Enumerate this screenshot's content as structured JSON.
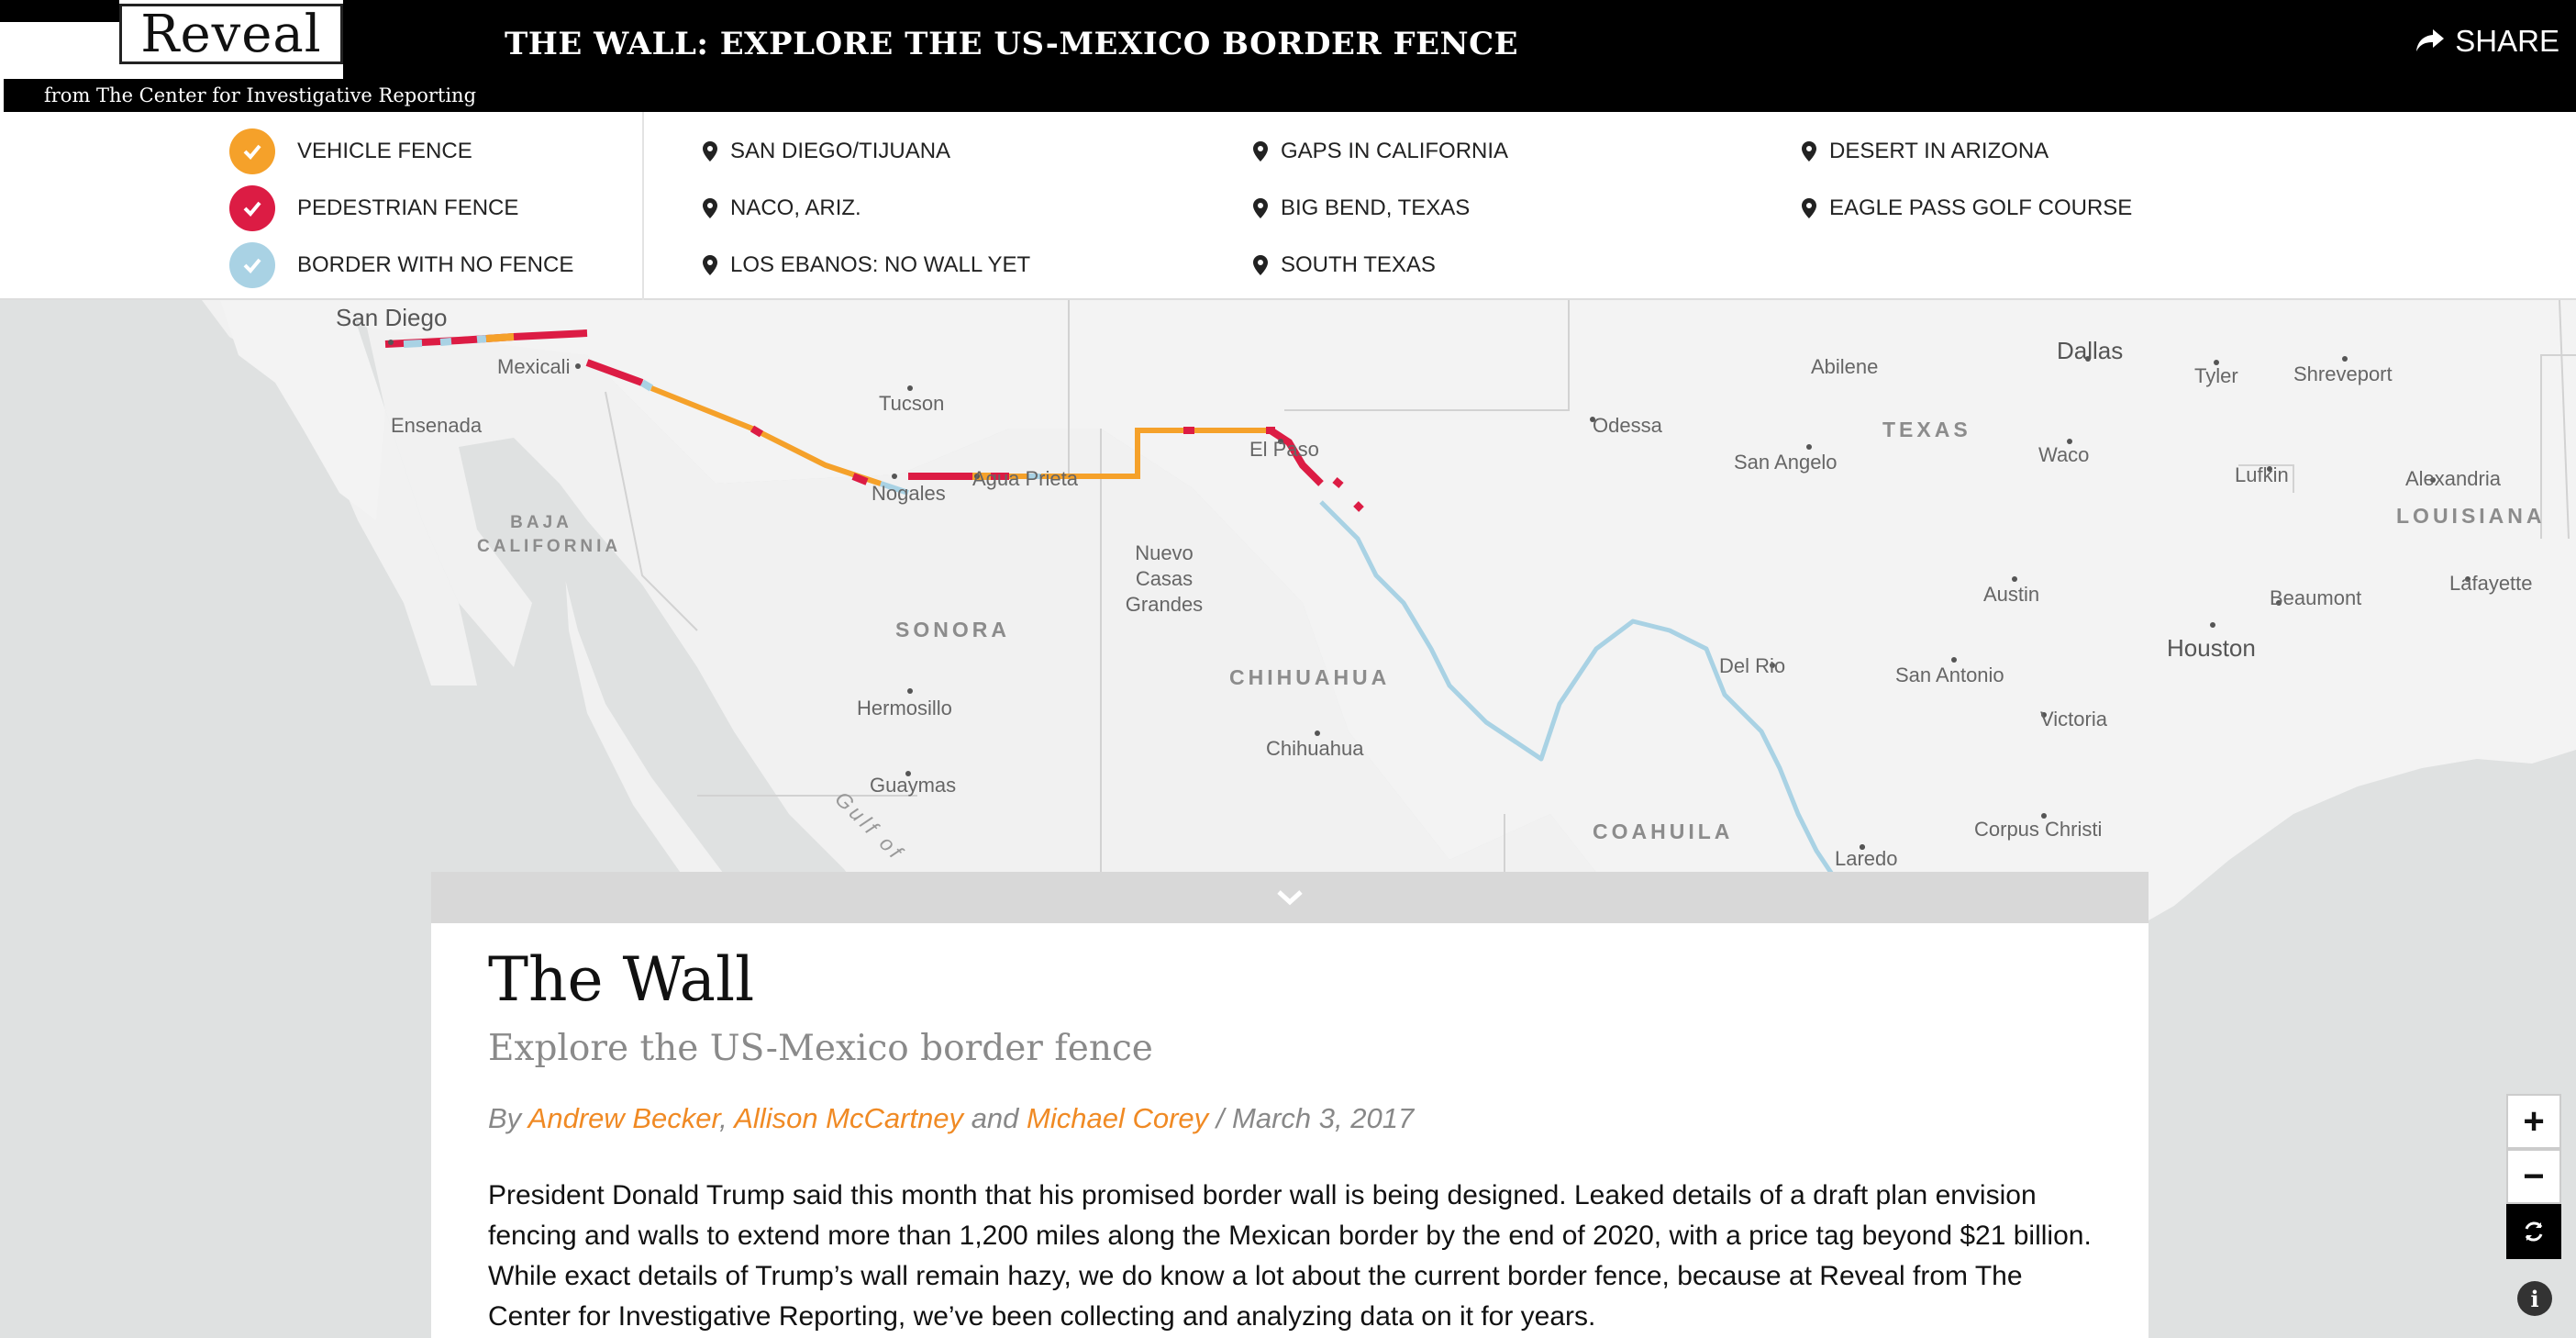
{
  "header": {
    "logo": "Reveal",
    "logo_sub": "from The Center for Investigative Reporting",
    "title": "THE WALL: EXPLORE THE US-MEXICO BORDER FENCE",
    "share_label": "SHARE"
  },
  "legend": [
    {
      "label": "VEHICLE FENCE",
      "color": "#f5a12a"
    },
    {
      "label": "PEDESTRIAN FENCE",
      "color": "#dc1c44"
    },
    {
      "label": "BORDER WITH NO FENCE",
      "color": "#a9d2e4"
    }
  ],
  "locations": {
    "col1": [
      "SAN DIEGO/TIJUANA",
      "NACO, ARIZ.",
      "LOS EBANOS: NO WALL YET"
    ],
    "col2": [
      "GAPS IN CALIFORNIA",
      "BIG BEND, TEXAS",
      "SOUTH TEXAS"
    ],
    "col3": [
      "DESERT IN ARIZONA",
      "EAGLE PASS GOLF COURSE"
    ]
  },
  "map": {
    "cities": {
      "san_diego": "San Diego",
      "mexicali": "Mexicali",
      "ensenada": "Ensenada",
      "tucson": "Tucson",
      "nogales": "Nogales",
      "agua_prieta": "Agua Prieta",
      "el_paso": "El Paso",
      "nuevo_casas_grandes": "Nuevo Casas Grandes",
      "hermosillo": "Hermosillo",
      "guaymas": "Guaymas",
      "chihuahua": "Chihuahua",
      "odessa": "Odessa",
      "abilene": "Abilene",
      "san_angelo": "San Angelo",
      "dallas": "Dallas",
      "tyler": "Tyler",
      "shreveport": "Shreveport",
      "waco": "Waco",
      "lufkin": "Lufkin",
      "alexandria": "Alexandria",
      "austin": "Austin",
      "beaumont": "Beaumont",
      "lafayette": "Lafayette",
      "houston": "Houston",
      "del_rio": "Del Rio",
      "san_antonio": "San Antonio",
      "victoria": "Victoria",
      "corpus_christi": "Corpus Christi",
      "laredo": "Laredo"
    },
    "regions": {
      "baja_california": "BAJA CALIFORNIA",
      "sonora": "SONORA",
      "chihuahua": "CHIHUAHUA",
      "coahuila": "COAHUILA",
      "texas": "TEXAS",
      "louisiana": "LOUISIANA",
      "gulf": "Gulf of"
    }
  },
  "article": {
    "title": "The Wall",
    "subtitle": "Explore the US-Mexico border fence",
    "by": "By",
    "author1": "Andrew Becker",
    "sep1": ",",
    "author2": "Allison McCartney",
    "and": "and",
    "author3": "Michael Corey",
    "date": "/ March 3, 2017",
    "body": "President Donald Trump said this month that his promised border wall is being designed. Leaked details of a draft plan envision fencing and walls to extend more than 1,200 miles along the Mexican border by the end of 2020, with a price tag beyond $21 billion. While exact details of Trump’s wall remain hazy, we do know a lot about the current border fence, because at Reveal from The Center for Investigative Reporting, we’ve been collecting and analyzing data on it for years."
  },
  "controls": {
    "zoom_in": "+",
    "zoom_out": "−",
    "info": "i"
  }
}
